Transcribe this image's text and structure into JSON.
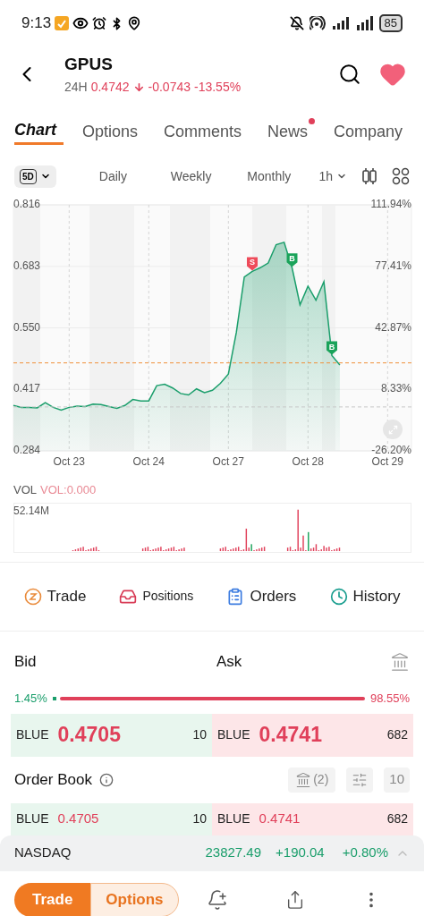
{
  "status_bar": {
    "time": "9:13",
    "battery": "85"
  },
  "header": {
    "symbol": "GPUS",
    "session": "24H",
    "price": "0.4742",
    "change": "-0.0743",
    "change_pct": "-13.55%",
    "favorite": true
  },
  "tabs": [
    {
      "label": "Chart",
      "selected": true,
      "badge": false
    },
    {
      "label": "Options",
      "selected": false,
      "badge": false
    },
    {
      "label": "Comments",
      "selected": false,
      "badge": false
    },
    {
      "label": "News",
      "selected": false,
      "badge": true
    },
    {
      "label": "Company",
      "selected": false,
      "badge": false
    }
  ],
  "periods": [
    {
      "label": "5D",
      "kind": "chip",
      "selected": true
    },
    {
      "label": "Daily",
      "kind": "text",
      "selected": false
    },
    {
      "label": "Weekly",
      "kind": "text",
      "selected": false
    },
    {
      "label": "Monthly",
      "kind": "text",
      "selected": false
    }
  ],
  "interval": "1h",
  "chart": {
    "right_labels": [
      "111.94%",
      "77.41%",
      "42.87%",
      "8.33%",
      "-26.20%"
    ],
    "chart_data": {
      "type": "area",
      "ylim": [
        0.284,
        0.816
      ],
      "yticks": [
        {
          "value": 0.816,
          "label": "0.816"
        },
        {
          "value": 0.683,
          "label": "0.683"
        },
        {
          "value": 0.55,
          "label": "0.550"
        },
        {
          "value": 0.417,
          "label": "0.417"
        },
        {
          "value": 0.284,
          "label": "0.284"
        }
      ],
      "categories": [
        null,
        null,
        null,
        null,
        null,
        null,
        null,
        "Oct 23",
        null,
        null,
        null,
        null,
        null,
        null,
        null,
        null,
        null,
        "Oct 24",
        null,
        null,
        null,
        null,
        null,
        null,
        null,
        null,
        null,
        "Oct 27",
        null,
        null,
        null,
        null,
        null,
        null,
        null,
        null,
        null,
        "Oct 28",
        null,
        null,
        null,
        null,
        null,
        null,
        null,
        null,
        null,
        "Oct 29",
        null,
        null,
        null
      ],
      "series": [
        {
          "color": "#1a9e6b",
          "values": [
            0.382,
            0.378,
            0.378,
            0.377,
            0.388,
            0.378,
            0.372,
            0.378,
            0.381,
            0.38,
            0.385,
            0.384,
            0.38,
            0.376,
            0.382,
            0.395,
            0.392,
            0.392,
            0.425,
            0.428,
            0.42,
            0.408,
            0.405,
            0.418,
            0.41,
            0.415,
            0.43,
            0.45,
            0.54,
            0.66,
            0.672,
            0.68,
            0.69,
            0.73,
            0.735,
            0.68,
            0.6,
            0.64,
            0.61,
            0.65,
            0.49,
            0.47,
            null,
            null,
            null,
            null,
            null,
            null,
            null,
            null,
            null
          ]
        }
      ],
      "grid": true,
      "ref_lines": [
        {
          "axis": "y",
          "value": 0.4742,
          "color": "#f0903a"
        },
        {
          "axis": "y",
          "value": 0.379,
          "color": "#c8c8c8"
        }
      ],
      "annotations": [
        "S",
        "B",
        "B"
      ]
    }
  },
  "volume": {
    "label": "VOL",
    "reading": "VOL:0.000",
    "max": "52.14M"
  },
  "actions": [
    {
      "label": "Trade",
      "kind": "trade"
    },
    {
      "label": "Positions",
      "kind": "positions"
    },
    {
      "label": "Orders",
      "kind": "orders"
    },
    {
      "label": "History",
      "kind": "history"
    }
  ],
  "quote": {
    "bid_label": "Bid",
    "ask_label": "Ask",
    "bid_pct": "1.45%",
    "ask_pct": "98.55%",
    "bid": {
      "venue": "BLUE",
      "price": "0.4705",
      "size": "10"
    },
    "ask": {
      "venue": "BLUE",
      "price": "0.4741",
      "size": "682"
    }
  },
  "order_book": {
    "title": "Order Book",
    "venues": "(2)",
    "depth": "10",
    "rows": [
      {
        "bid": {
          "venue": "BLUE",
          "price": "0.4705",
          "size": "10"
        },
        "ask": {
          "venue": "BLUE",
          "price": "0.4741",
          "size": "682"
        }
      }
    ]
  },
  "index_bar": {
    "name": "NASDAQ",
    "value": "23827.49",
    "change": "+190.04",
    "change_pct": "+0.80%"
  },
  "bottom_bar": {
    "primary": "Trade",
    "secondary": "Options"
  }
}
